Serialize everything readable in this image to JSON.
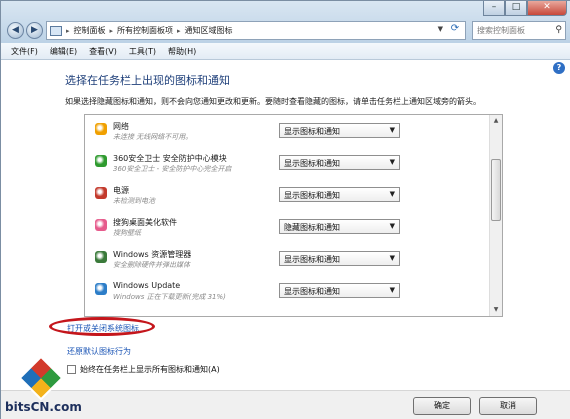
{
  "window": {
    "breadcrumbs": [
      "控制面板",
      "所有控制面板项",
      "通知区域图标"
    ],
    "search_placeholder": "搜索控制面板",
    "minimize": "–",
    "maximize": "□",
    "close": "✕"
  },
  "menu": [
    "文件(F)",
    "编辑(E)",
    "查看(V)",
    "工具(T)",
    "帮助(H)"
  ],
  "main": {
    "heading": "选择在任务栏上出现的图标和通知",
    "description": "如果选择隐藏图标和通知，则不会向您通知更改和更新。要随时查看隐藏的图标，请单击任务栏上通知区域旁的箭头。",
    "items": [
      {
        "title": "网络",
        "subtitle": "未连接 无线网络不可用。",
        "behavior": "显示图标和通知",
        "icon": "network-icon",
        "color": "#f0a000"
      },
      {
        "title": "360安全卫士 安全防护中心模块",
        "subtitle": "360安全卫士 - 安全防护中心完全开启",
        "behavior": "显示图标和通知",
        "icon": "360-icon",
        "color": "#2f9b2f"
      },
      {
        "title": "电源",
        "subtitle": "未检测到电池",
        "behavior": "显示图标和通知",
        "icon": "power-icon",
        "color": "#c33a2c"
      },
      {
        "title": "搜狗桌面美化软件",
        "subtitle": "搜狗壁纸",
        "behavior": "隐藏图标和通知",
        "icon": "sogou-icon",
        "color": "#e65b8c"
      },
      {
        "title": "Windows 资源管理器",
        "subtitle": "安全删除硬件并弹出媒体",
        "behavior": "显示图标和通知",
        "icon": "usb-icon",
        "color": "#3a7a3a"
      },
      {
        "title": "Windows Update",
        "subtitle": "Windows 正在下载更新(完成 31%)",
        "behavior": "显示图标和通知",
        "icon": "update-icon",
        "color": "#2c7dc8"
      }
    ],
    "link_system_icons": "打开或关闭系统图标",
    "link_restore": "还原默认图标行为",
    "checkbox_label": "始终在任务栏上显示所有图标和通知(A)"
  },
  "footer": {
    "ok": "确定",
    "cancel": "取消"
  },
  "watermark": {
    "text": "bitsCN.com"
  }
}
